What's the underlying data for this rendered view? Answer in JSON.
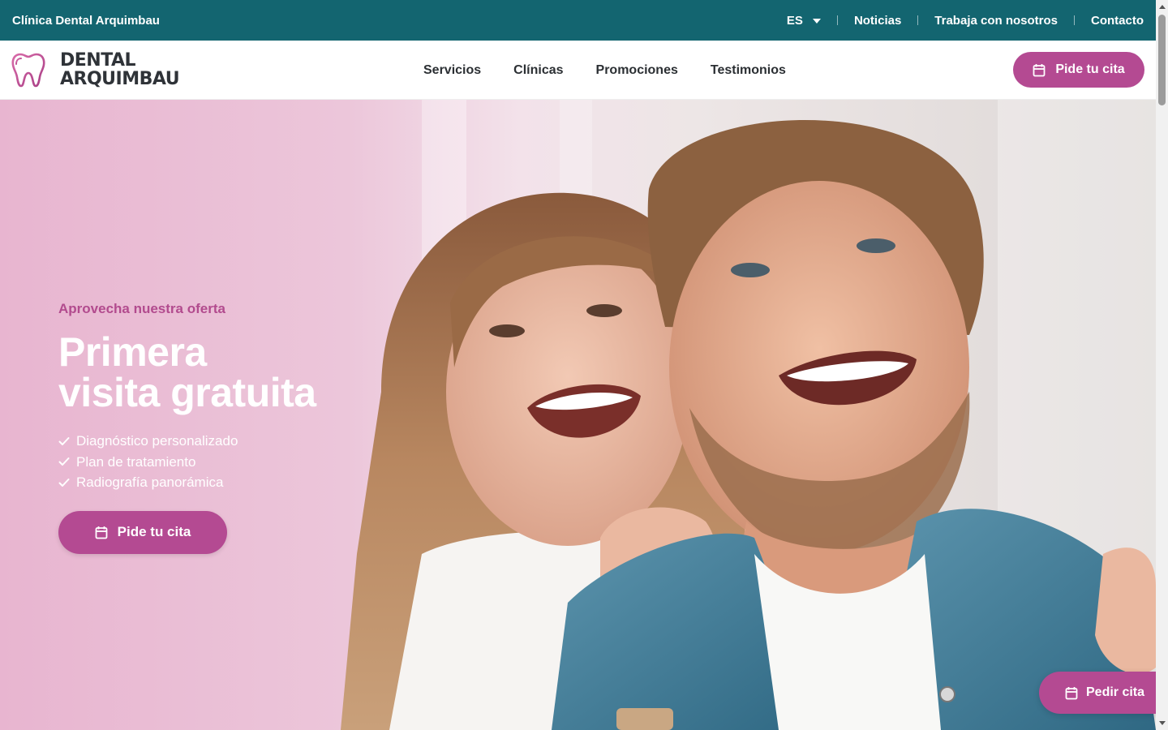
{
  "topbar": {
    "brand": "Clínica Dental Arquimbau",
    "language": "ES",
    "links": [
      "Noticias",
      "Trabaja con nosotros",
      "Contacto"
    ]
  },
  "header": {
    "logo_line1": "DENTAL",
    "logo_line2": "ARQUIMBAU",
    "nav": [
      "Servicios",
      "Clínicas",
      "Promociones",
      "Testimonios"
    ],
    "cta": "Pide tu cita"
  },
  "hero": {
    "kicker": "Aprovecha nuestra oferta",
    "title_line1": "Primera",
    "title_line2": "visita gratuita",
    "features": [
      "Diagnóstico personalizado",
      "Plan de tratamiento",
      "Radiografía panorámica"
    ],
    "cta": "Pide tu cita"
  },
  "floating_cta": "Pedir cita",
  "colors": {
    "topbar": "#136570",
    "accent": "#b44a92"
  },
  "icons": {
    "calendar": "calendar-icon",
    "check": "check-icon",
    "tooth": "tooth-logo"
  }
}
